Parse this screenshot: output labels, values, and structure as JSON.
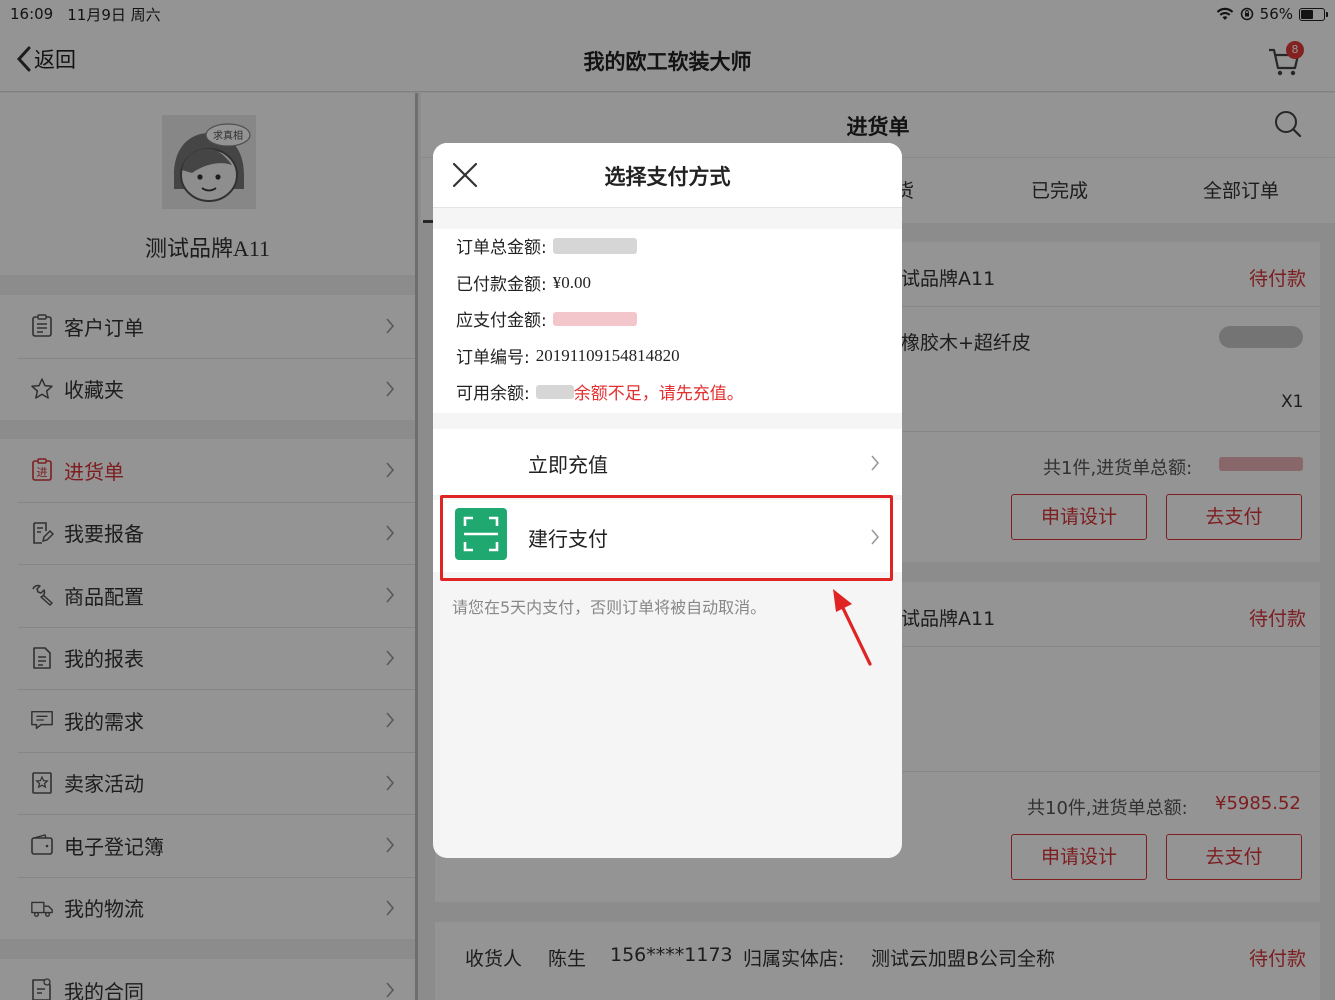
{
  "status_bar": {
    "time": "16:09",
    "date": "11月9日 周六",
    "battery": "56%",
    "battery_level": 0.56
  },
  "nav": {
    "back_label": "返回",
    "title": "我的欧工软装大师",
    "cart_count": "8"
  },
  "sidebar": {
    "profile_name": "测试品牌A11",
    "avatar_caption": "求真相",
    "groups": [
      [
        {
          "label": "客户订单",
          "icon": "clipboard-icon"
        },
        {
          "label": "收藏夹",
          "icon": "star-icon"
        }
      ],
      [
        {
          "label": "进货单",
          "icon": "stock-icon",
          "icon_text": "进",
          "active": true
        },
        {
          "label": "我要报备",
          "icon": "edit-doc-icon"
        },
        {
          "label": "商品配置",
          "icon": "wrench-icon"
        },
        {
          "label": "我的报表",
          "icon": "report-icon"
        },
        {
          "label": "我的需求",
          "icon": "chat-icon"
        },
        {
          "label": "卖家活动",
          "icon": "activity-icon"
        },
        {
          "label": "电子登记簿",
          "icon": "wallet-icon"
        },
        {
          "label": "我的物流",
          "icon": "truck-icon"
        }
      ],
      [
        {
          "label": "我的合同",
          "icon": "contract-icon"
        }
      ]
    ]
  },
  "main": {
    "title": "进货单",
    "tabs": [
      {
        "label": "货"
      },
      {
        "label": "已完成"
      },
      {
        "label": "全部订单"
      }
    ],
    "orders": [
      {
        "shop": "试品牌A11",
        "status": "待付款",
        "product": "橡胶木+超纤皮",
        "qty": "X1",
        "summary": "共1件,进货单总额:",
        "design_btn": "申请设计",
        "pay_btn": "去支付"
      },
      {
        "shop": "试品牌A11",
        "status": "待付款",
        "summary": "共10件,进货单总额:",
        "total": "¥5985.52",
        "design_btn": "申请设计",
        "pay_btn": "去支付"
      },
      {
        "receiver_label": "收货人",
        "receiver_name": "陈生",
        "phone": "156****1173",
        "store_label": "归属实体店:",
        "store_name": "测试云加盟B公司全称",
        "status": "待付款"
      }
    ]
  },
  "modal": {
    "title": "选择支付方式",
    "order_total_label": "订单总金额:",
    "paid_label": "已付款金额:",
    "paid_value": "¥0.00",
    "payable_label": "应支付金额:",
    "order_no_label": "订单编号:",
    "order_no_value": "20191109154814820",
    "balance_label": "可用余额:",
    "balance_warning": "余额不足，请先充值。",
    "recharge_label": "立即充值",
    "ccb_label": "建行支付",
    "notice": "请您在5天内支付，否则订单将被自动取消。"
  },
  "colors": {
    "accent_red": "#d8343a",
    "ccb_green": "#1fa870",
    "highlight": "#e02424"
  }
}
